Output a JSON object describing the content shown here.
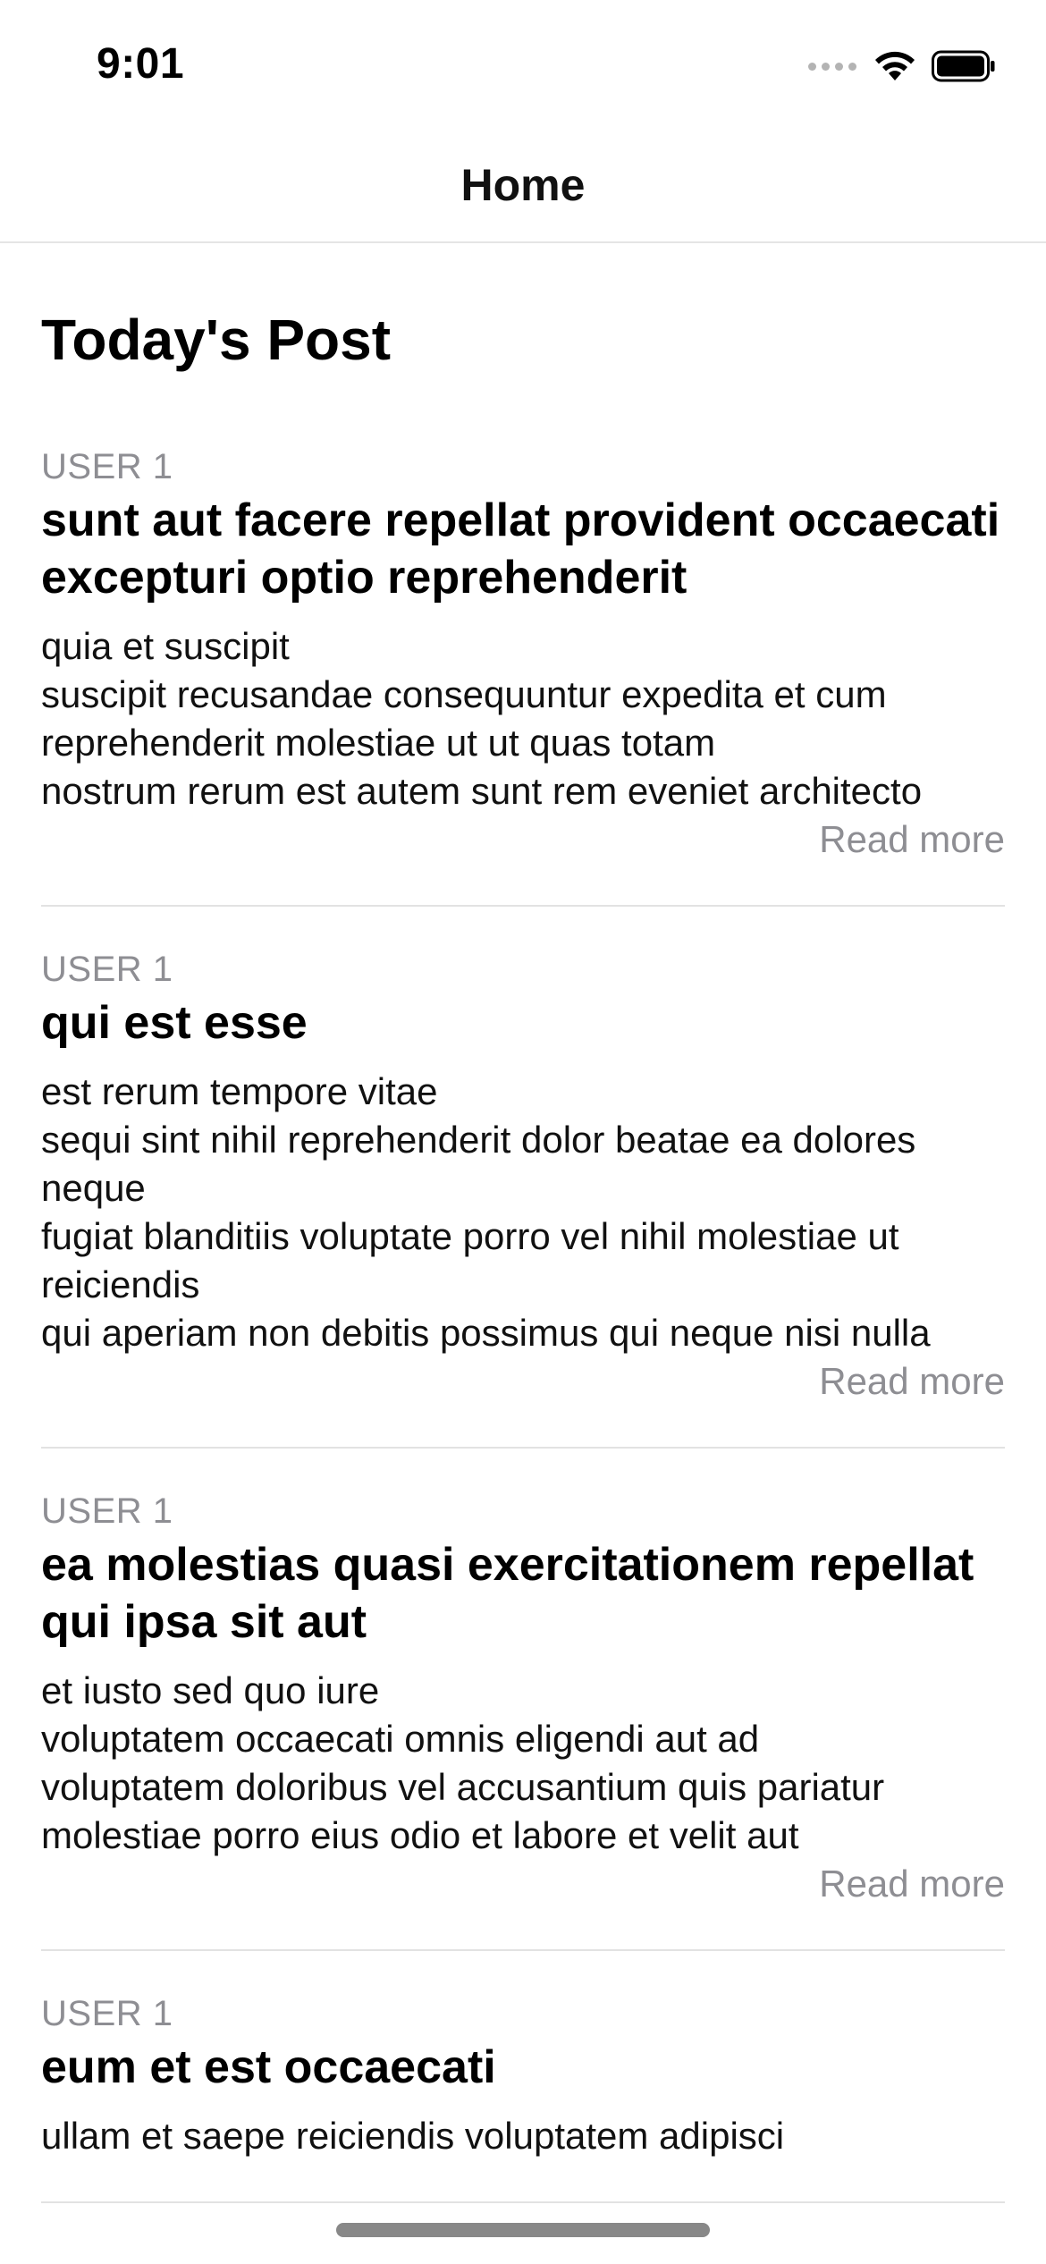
{
  "status_bar": {
    "time": "9:01"
  },
  "nav": {
    "title": "Home"
  },
  "main": {
    "section_title": "Today's Post",
    "read_more_label": "Read more",
    "posts": [
      {
        "user": "USER 1",
        "title": "sunt aut facere repellat provident occaecati excepturi optio reprehenderit",
        "body": "quia et suscipit\nsuscipit recusandae consequuntur expedita et cum reprehenderit molestiae ut ut quas totam\nnostrum rerum est autem sunt rem eveniet architecto"
      },
      {
        "user": "USER 1",
        "title": "qui est esse",
        "body": "est rerum tempore vitae\nsequi sint nihil reprehenderit dolor beatae ea dolores neque\nfugiat blanditiis voluptate porro vel nihil molestiae ut reiciendis\nqui aperiam non debitis possimus qui neque nisi nulla"
      },
      {
        "user": "USER 1",
        "title": "ea molestias quasi exercitationem repellat qui ipsa sit aut",
        "body": "et iusto sed quo iure\nvoluptatem occaecati omnis eligendi aut ad\nvoluptatem doloribus vel accusantium quis pariatur\nmolestiae porro eius odio et labore et velit aut"
      },
      {
        "user": "USER 1",
        "title": "eum et est occaecati",
        "body": "ullam et saepe reiciendis voluptatem adipisci"
      }
    ]
  },
  "colors": {
    "secondary_text": "#8e8e93",
    "divider": "#e2e2e2",
    "background": "#ffffff"
  },
  "icons": [
    "cellular-signal-icon",
    "wifi-icon",
    "battery-icon"
  ]
}
